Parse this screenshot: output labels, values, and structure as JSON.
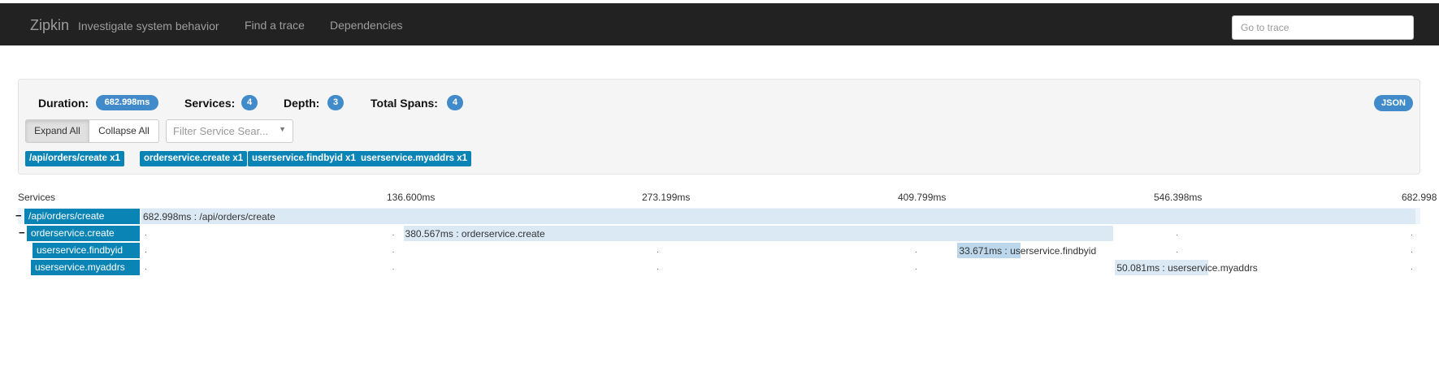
{
  "navbar": {
    "brand": "Zipkin",
    "tagline": "Investigate system behavior",
    "links": [
      "Find a trace",
      "Dependencies"
    ],
    "goto_placeholder": "Go to trace"
  },
  "summary": {
    "duration_label": "Duration:",
    "duration_value": "682.998ms",
    "services_label": "Services:",
    "services_value": "4",
    "depth_label": "Depth:",
    "depth_value": "3",
    "total_spans_label": "Total Spans:",
    "total_spans_value": "4",
    "json_label": "JSON",
    "expand_all": "Expand All",
    "collapse_all": "Collapse All",
    "filter_placeholder": "Filter Service Sear...",
    "service_tags": [
      "/api/orders/create x1",
      "orderservice.create x1",
      "userservice.findbyid x1",
      "userservice.myaddrs x1"
    ]
  },
  "timeline": {
    "services_header": "Services",
    "ticks": [
      "136.600ms",
      "273.199ms",
      "409.799ms",
      "546.398ms",
      "682.998"
    ],
    "total_ms": 682.998,
    "rows": [
      {
        "service": "/api/orders/create",
        "toggle": "−",
        "span_label": "682.998ms : /api/orders/create",
        "start_ms": 0,
        "duration_ms": 682.998
      },
      {
        "service": "orderservice.create",
        "toggle": "−",
        "span_label": "380.567ms : orderservice.create",
        "start_ms": 140.5,
        "duration_ms": 380.567
      },
      {
        "service": "userservice.findbyid",
        "toggle": "",
        "span_label": "33.671ms : userservice.findbyid",
        "start_ms": 437.5,
        "duration_ms": 33.671
      },
      {
        "service": "userservice.myaddrs",
        "toggle": "",
        "span_label": "50.081ms : userservice.myaddrs",
        "start_ms": 522.0,
        "duration_ms": 50.081
      }
    ]
  },
  "colors": {
    "navbar_bg": "#222222",
    "badge": "#428bca",
    "service_tag": "#0a84b5",
    "span_bar": "#dbe9f5"
  }
}
